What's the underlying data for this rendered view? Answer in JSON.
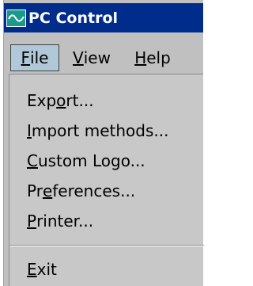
{
  "window": {
    "title": "PC Control",
    "icon": "waveform-app-icon"
  },
  "menubar": {
    "items": [
      {
        "mnemonic": "F",
        "rest": "ile",
        "active": true
      },
      {
        "mnemonic": "V",
        "rest": "iew",
        "active": false
      },
      {
        "mnemonic": "H",
        "rest": "elp",
        "active": false
      }
    ]
  },
  "file_menu": {
    "items": [
      {
        "pre": "Exp",
        "mnemonic": "o",
        "post": "rt..."
      },
      {
        "pre": "",
        "mnemonic": "I",
        "post": "mport methods..."
      },
      {
        "pre": "",
        "mnemonic": "C",
        "post": "ustom Logo..."
      },
      {
        "pre": "Pr",
        "mnemonic": "e",
        "post": "ferences..."
      },
      {
        "pre": "",
        "mnemonic": "P",
        "post": "rinter..."
      },
      {
        "pre": "",
        "mnemonic": "E",
        "post": "xit"
      }
    ]
  },
  "colors": {
    "titlebar": "#002d8c",
    "menu_bg": "#c0c0c0",
    "active_menu": "#b0c8d8"
  }
}
